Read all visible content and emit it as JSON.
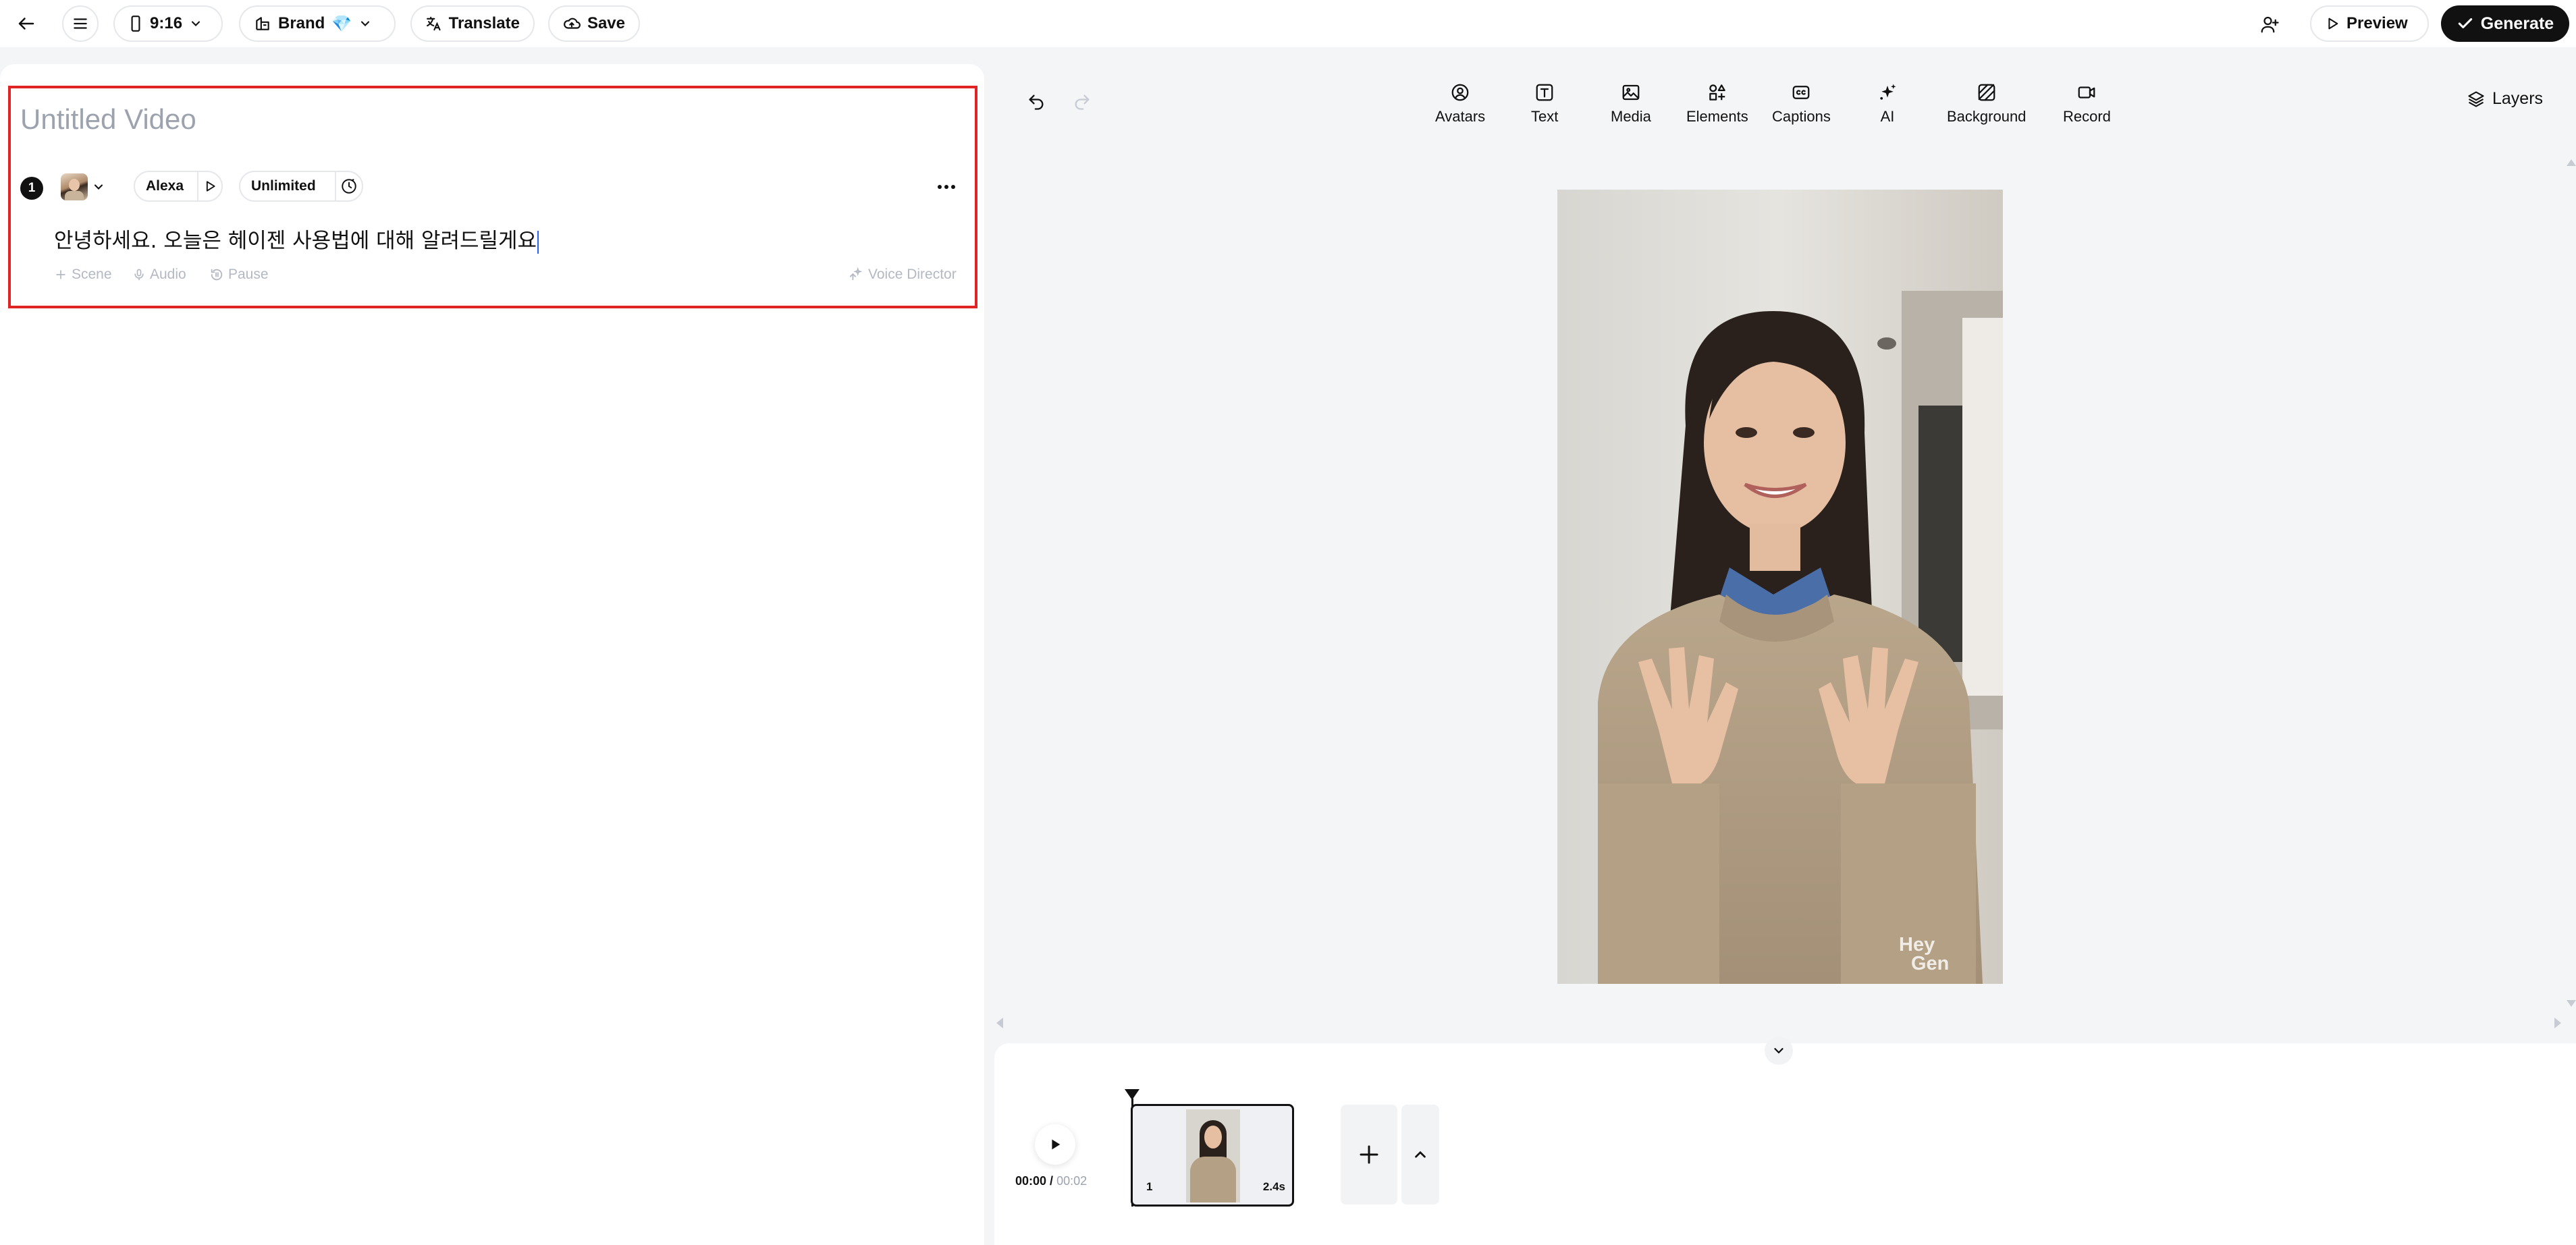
{
  "topbar": {
    "aspect_ratio": "9:16",
    "brand_label": "Brand",
    "brand_emoji": "💎",
    "translate_label": "Translate",
    "save_label": "Save",
    "preview_label": "Preview",
    "generate_label": "Generate"
  },
  "editor": {
    "title_placeholder": "Untitled Video",
    "scene": {
      "number": "1",
      "voice_name": "Alexa",
      "plan_label": "Unlimited",
      "script": "안녕하세요. 오늘은 헤이젠 사용법에 대해 알려드릴게요",
      "actions": {
        "scene": "Scene",
        "audio": "Audio",
        "pause": "Pause",
        "voice_director": "Voice Director"
      }
    }
  },
  "canvas_toolbar": {
    "items": [
      "Avatars",
      "Text",
      "Media",
      "Elements",
      "Captions",
      "AI",
      "Background",
      "Record"
    ],
    "layers_label": "Layers"
  },
  "preview": {
    "watermark_line1": "Hey",
    "watermark_line2": "Gen"
  },
  "timeline": {
    "current_time": "00:00",
    "separator": " / ",
    "total_time": "00:02",
    "clip_index": "1",
    "clip_duration": "2.4s"
  },
  "colors": {
    "highlight_border": "#e02424",
    "generate_bg": "#111111",
    "caret": "#2563eb"
  }
}
